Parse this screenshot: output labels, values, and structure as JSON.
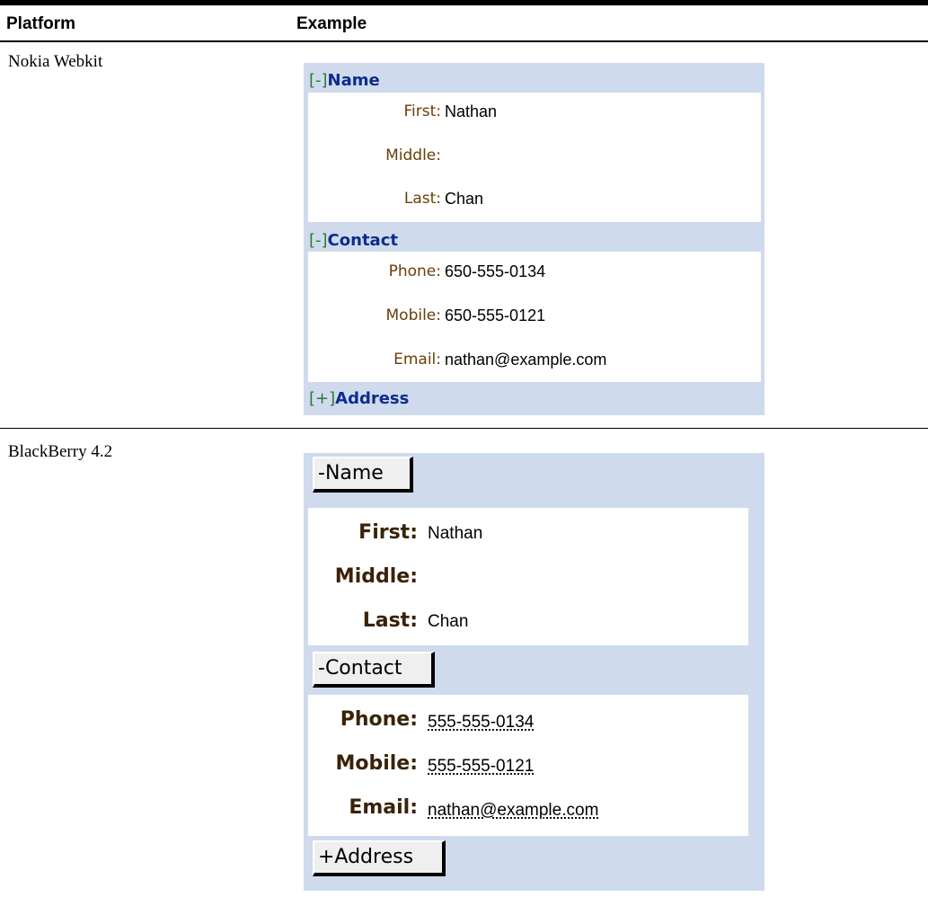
{
  "table": {
    "headers": {
      "platform": "Platform",
      "example": "Example"
    },
    "rows": [
      {
        "platform": "Nokia Webkit",
        "sections": [
          {
            "bracket": "[-]",
            "title": "Name"
          },
          {
            "bracket": "[-]",
            "title": "Contact"
          },
          {
            "bracket": "[+]",
            "title": "Address"
          }
        ],
        "name_fields": [
          {
            "label": "First:",
            "value": "Nathan"
          },
          {
            "label": "Middle:",
            "value": ""
          },
          {
            "label": "Last:",
            "value": "Chan"
          }
        ],
        "contact_fields": [
          {
            "label": "Phone:",
            "value": "650-555-0134"
          },
          {
            "label": "Mobile:",
            "value": "650-555-0121"
          },
          {
            "label": "Email:",
            "value": "nathan@example.com"
          }
        ]
      },
      {
        "platform": "BlackBerry 4.2",
        "buttons": [
          "-Name",
          "-Contact",
          "+Address"
        ],
        "name_fields": [
          {
            "label": "First:",
            "value": "Nathan"
          },
          {
            "label": "Middle:",
            "value": ""
          },
          {
            "label": "Last:",
            "value": "Chan"
          }
        ],
        "contact_fields": [
          {
            "label": "Phone:",
            "value": "555-555-0134"
          },
          {
            "label": "Mobile:",
            "value": "555-555-0121"
          },
          {
            "label": "Email:",
            "value": "nathan@example.com"
          }
        ]
      }
    ]
  },
  "colors": {
    "panel_background": "#cfdbec",
    "nokia_section_title": "#0e2c8e",
    "nokia_bracket": "#2f7a3c",
    "nokia_label": "#6a3e06",
    "blackberry_label": "#3a2208"
  }
}
